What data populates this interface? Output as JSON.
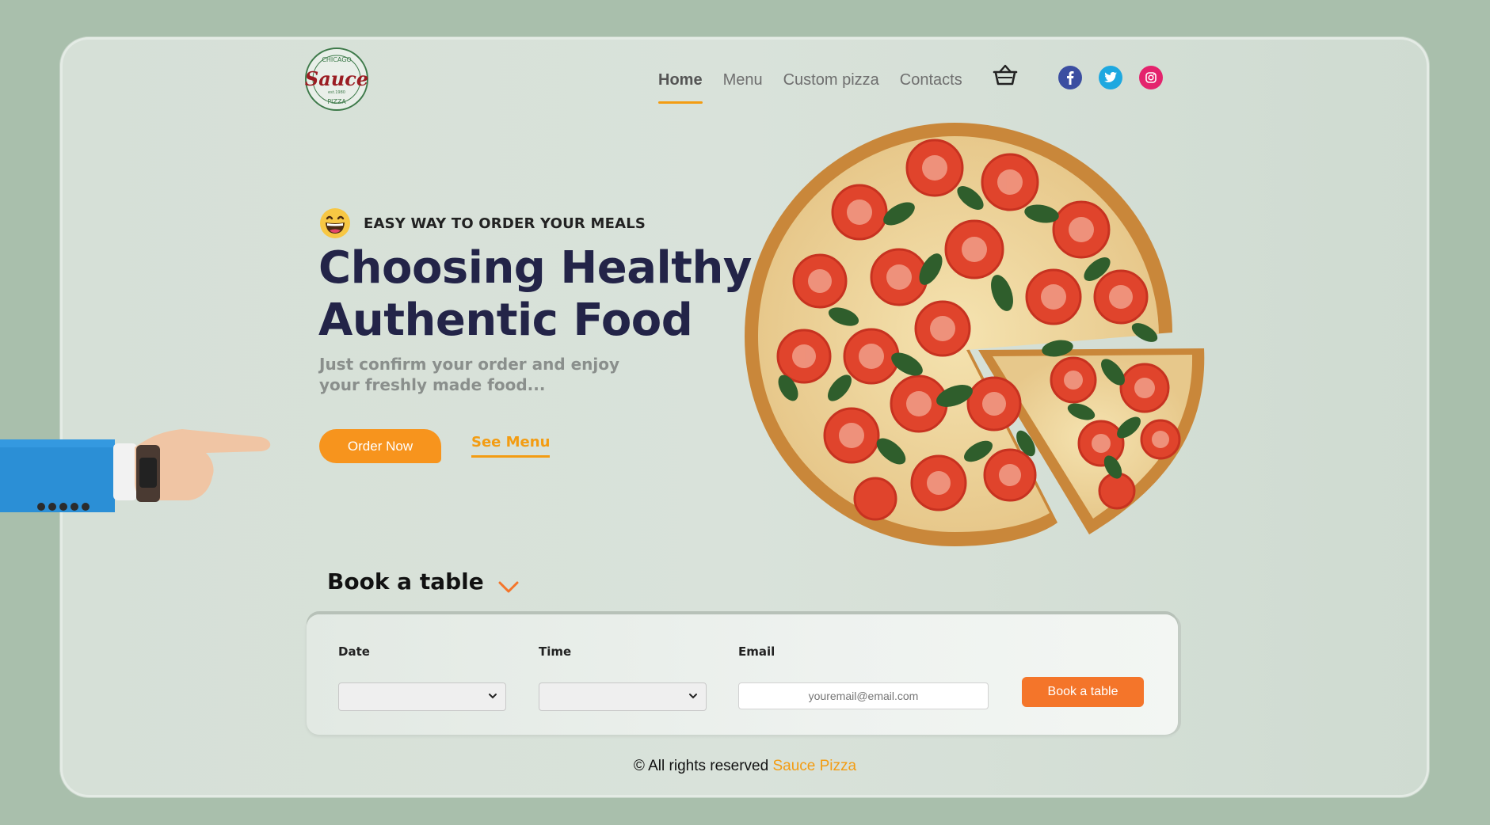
{
  "logo": {
    "top_text": "CHICAGO",
    "main_text": "Sauce",
    "est_text": "est.1980",
    "bottom_text": "PIZZA"
  },
  "nav": {
    "items": [
      {
        "label": "Home",
        "active": true
      },
      {
        "label": "Menu",
        "active": false
      },
      {
        "label": "Custom pizza",
        "active": false
      },
      {
        "label": "Contacts",
        "active": false
      }
    ],
    "cart_icon": "basket-icon",
    "social": [
      {
        "icon": "facebook-icon",
        "color": "#3b4ea1"
      },
      {
        "icon": "twitter-icon",
        "color": "#1ea8e0"
      },
      {
        "icon": "instagram-icon",
        "color": "#e4236d"
      }
    ]
  },
  "hero": {
    "tagline": "EASY WAY TO ORDER YOUR MEALS",
    "headline_line1": "Choosing Healthy &",
    "headline_line2": "Authentic Food",
    "subtitle_line1": "Just confirm your order and enjoy",
    "subtitle_line2": "your freshly made food...",
    "order_button": "Order Now",
    "menu_link": "See Menu"
  },
  "booking": {
    "title": "Book a table",
    "date_label": "Date",
    "time_label": "Time",
    "email_label": "Email",
    "email_placeholder": "youremail@email.com",
    "submit_label": "Book a table"
  },
  "footer": {
    "text": "© All rights reserved",
    "brand": "Sauce Pizza"
  },
  "colors": {
    "accent": "#f39c12",
    "book_button": "#f4752a",
    "heading": "#232448",
    "background": "#a9bfac"
  }
}
